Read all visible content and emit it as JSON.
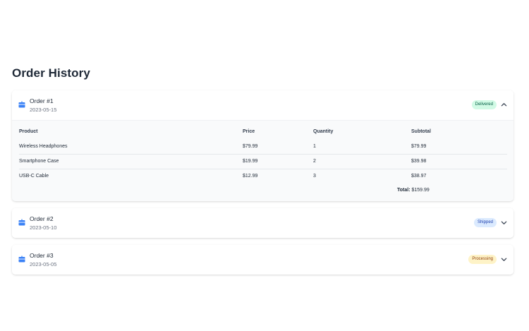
{
  "page": {
    "title": "Order History"
  },
  "table_headers": {
    "product": "Product",
    "price": "Price",
    "quantity": "Quantity",
    "subtotal": "Subtotal"
  },
  "orders": [
    {
      "number": "Order #1",
      "date": "2023-05-15",
      "status": "Delivered",
      "expanded": true,
      "items": [
        {
          "product": "Wireless Headphones",
          "price": "$79.99",
          "quantity": "1",
          "subtotal": "$79.99"
        },
        {
          "product": "Smartphone Case",
          "price": "$19.99",
          "quantity": "2",
          "subtotal": "$39.98"
        },
        {
          "product": "USB-C Cable",
          "price": "$12.99",
          "quantity": "3",
          "subtotal": "$38.97"
        }
      ],
      "total_label": "Total:",
      "total_value": "$159.99"
    },
    {
      "number": "Order #2",
      "date": "2023-05-10",
      "status": "Shipped",
      "expanded": false
    },
    {
      "number": "Order #3",
      "date": "2023-05-05",
      "status": "Processing",
      "expanded": false
    }
  ],
  "colors": {
    "icon_blue": "#3b82f6",
    "delivered_bg": "#d1fae5",
    "shipped_bg": "#dbeafe",
    "processing_bg": "#fef3c7"
  },
  "icons": {
    "order": "package-icon",
    "expanded": "chevron-up-icon",
    "collapsed": "chevron-down-icon"
  }
}
